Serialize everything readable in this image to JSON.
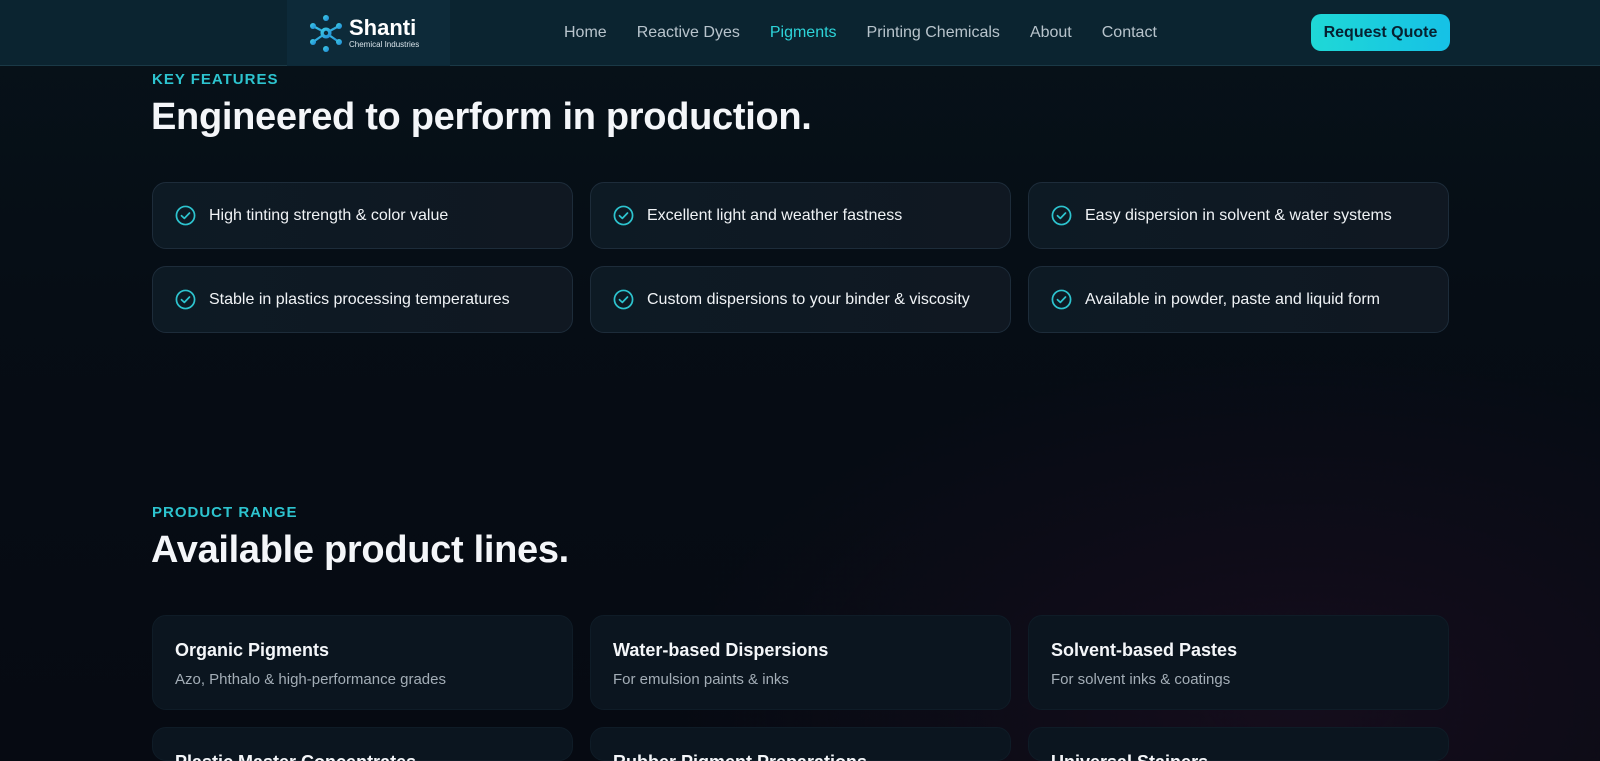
{
  "header": {
    "brand_name": "Shanti",
    "brand_sub": "Chemical Industries",
    "nav": [
      {
        "label": "Home"
      },
      {
        "label": "Reactive Dyes"
      },
      {
        "label": "Pigments"
      },
      {
        "label": "Printing Chemicals"
      },
      {
        "label": "About"
      },
      {
        "label": "Contact"
      }
    ],
    "active_nav": "Pigments",
    "cta_label": "Request Quote",
    "accent_color": "#2dd4d9"
  },
  "features": {
    "eyebrow": "KEY FEATURES",
    "title": "Engineered to perform in production.",
    "icon": "check-circle-icon",
    "items": [
      {
        "text": "High tinting strength & color value"
      },
      {
        "text": "Excellent light and weather fastness"
      },
      {
        "text": "Easy dispersion in solvent & water systems"
      },
      {
        "text": "Stable in plastics processing temperatures"
      },
      {
        "text": "Custom dispersions to your binder & viscosity"
      },
      {
        "text": "Available in powder, paste and liquid form"
      }
    ]
  },
  "products": {
    "eyebrow": "PRODUCT RANGE",
    "title": "Available product lines.",
    "items": [
      {
        "title": "Organic Pigments",
        "desc": "Azo, Phthalo & high-performance grades"
      },
      {
        "title": "Water-based Dispersions",
        "desc": "For emulsion paints & inks"
      },
      {
        "title": "Solvent-based Pastes",
        "desc": "For solvent inks & coatings"
      },
      {
        "title": "Plastic Master Concentrates",
        "desc": ""
      },
      {
        "title": "Rubber Pigment Preparations",
        "desc": ""
      },
      {
        "title": "Universal Stainers",
        "desc": ""
      }
    ]
  }
}
